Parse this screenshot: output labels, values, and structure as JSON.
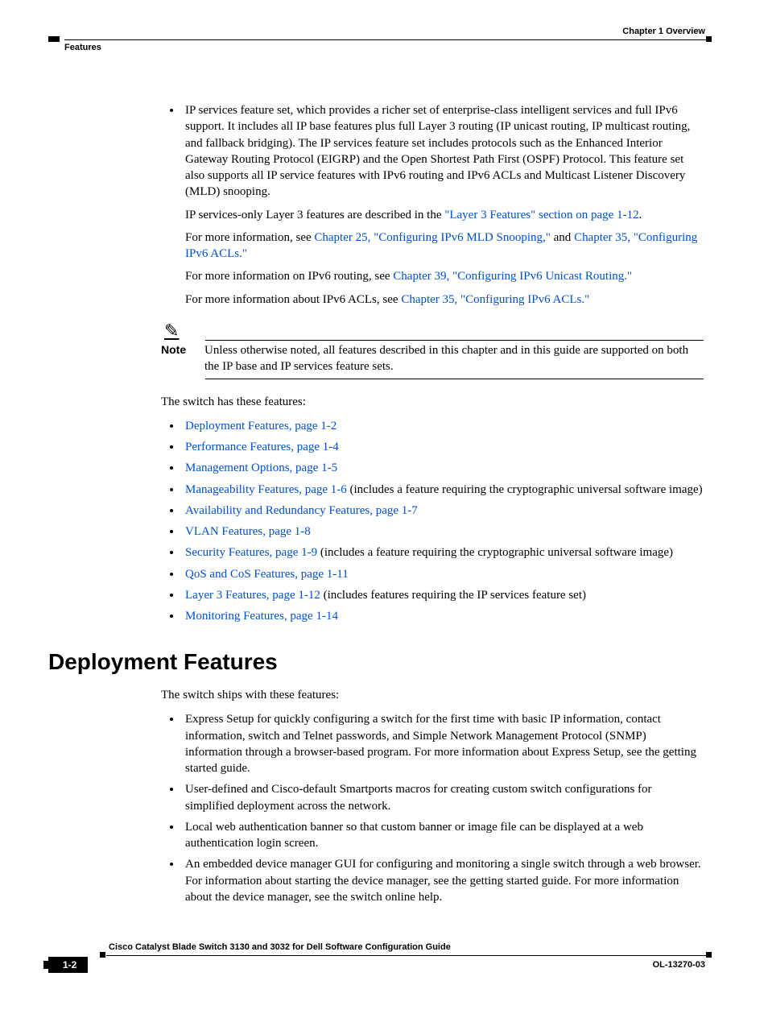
{
  "header": {
    "chapter": "Chapter 1      Overview",
    "section": "Features"
  },
  "main_bullet": {
    "text": "IP services feature set, which provides a richer set of enterprise-class intelligent services and full IPv6 support. It includes all IP base features plus full Layer 3 routing (IP unicast routing, IP multicast routing, and fallback bridging). The IP services feature set includes protocols such as the Enhanced Interior Gateway Routing Protocol (EIGRP) and the Open Shortest Path First (OSPF) Protocol. This feature set also supports all IP service features with IPv6 routing and IPv6 ACLs and Multicast Listener Discovery (MLD) snooping."
  },
  "indent_paras": [
    {
      "pre": "IP services-only Layer 3 features are described in the ",
      "link": "\"Layer 3 Features\" section on page 1-12",
      "post": "."
    },
    {
      "pre": "For more information, see ",
      "link": "Chapter 25, \"Configuring IPv6 MLD Snooping,\"",
      "mid": " and ",
      "link2": "Chapter 35, \"Configuring IPv6 ACLs.\"",
      "post": ""
    },
    {
      "pre": "For more information on IPv6 routing, see ",
      "link": "Chapter 39, \"Configuring IPv6 Unicast Routing.\"",
      "post": ""
    },
    {
      "pre": "For more information about IPv6 ACLs, see ",
      "link": "Chapter 35, \"Configuring IPv6 ACLs.\"",
      "post": ""
    }
  ],
  "note": {
    "label": "Note",
    "text": "Unless otherwise noted, all features described in this chapter and in this guide are supported on both the IP base and IP services feature sets."
  },
  "intro_para": "The switch has these features:",
  "feature_links": [
    {
      "link": "Deployment Features, page 1-2",
      "suffix": ""
    },
    {
      "link": "Performance Features, page 1-4",
      "suffix": ""
    },
    {
      "link": "Management Options, page 1-5",
      "suffix": ""
    },
    {
      "link": "Manageability Features, page 1-6",
      "suffix": " (includes a feature requiring the cryptographic universal software image)"
    },
    {
      "link": "Availability and Redundancy Features, page 1-7",
      "suffix": ""
    },
    {
      "link": "VLAN Features, page 1-8",
      "suffix": ""
    },
    {
      "link": "Security Features, page 1-9",
      "suffix": " (includes a feature requiring the cryptographic universal software image)"
    },
    {
      "link": "QoS and CoS Features, page 1-11",
      "suffix": ""
    },
    {
      "link": "Layer 3 Features, page 1-12",
      "suffix": " (includes features requiring the IP services feature set)"
    },
    {
      "link": "Monitoring Features, page 1-14",
      "suffix": ""
    }
  ],
  "section_heading": "Deployment Features",
  "section_intro": "The switch ships with these features:",
  "deploy_bullets": [
    "Express Setup for quickly configuring a switch for the first time with basic IP information, contact information, switch and Telnet passwords, and Simple Network Management Protocol (SNMP) information through a browser-based program. For more information about Express Setup, see the getting started guide.",
    "User-defined and Cisco-default Smartports macros for creating custom switch configurations for simplified deployment across the network.",
    "Local web authentication banner so that custom banner or image file can be displayed at a web authentication login screen.",
    "An embedded device manager GUI for configuring and monitoring a single switch through a web browser. For information about starting the device manager, see the getting started guide. For more information about the device manager, see the switch online help."
  ],
  "footer": {
    "guide": "Cisco Catalyst Blade Switch 3130 and 3032 for Dell Software Configuration Guide",
    "page": "1-2",
    "docid": "OL-13270-03"
  }
}
